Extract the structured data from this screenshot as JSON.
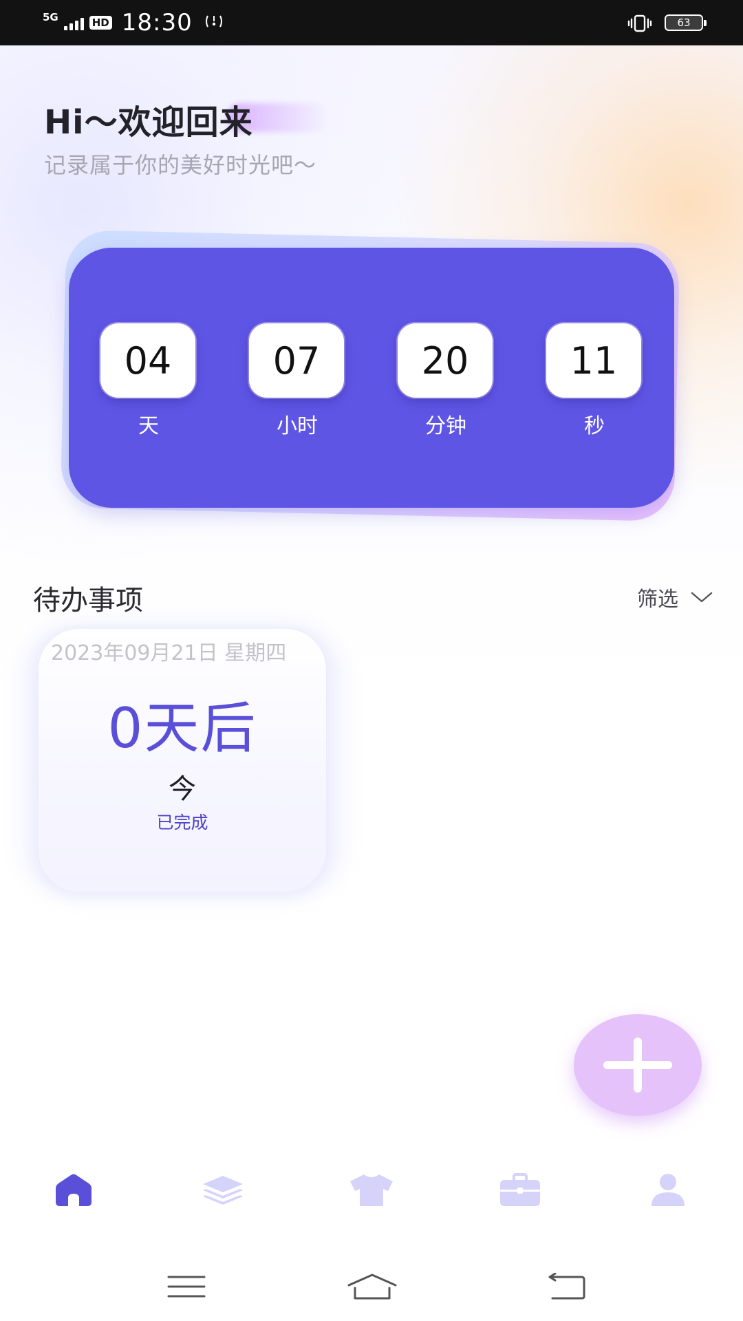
{
  "status_bar": {
    "network": "5G",
    "hd": "HD",
    "time": "18:30",
    "battery": "63",
    "icons": [
      "signal-icon",
      "hd-icon",
      "wifi-call-icon",
      "vibrate-icon",
      "battery-icon"
    ]
  },
  "greeting": {
    "title": "Hi～欢迎回来",
    "subtitle": "记录属于你的美好时光吧～"
  },
  "countdown": {
    "days_value": "04",
    "days_label": "天",
    "hours_value": "07",
    "hours_label": "小时",
    "minutes_value": "20",
    "minutes_label": "分钟",
    "seconds_value": "11",
    "seconds_label": "秒"
  },
  "todo": {
    "section_title": "待办事项",
    "filter_label": "筛选",
    "card": {
      "date": "2023年09月21日 星期四",
      "countdown": "0天后",
      "name": "今",
      "status": "已完成"
    }
  },
  "tabs": [
    {
      "icon": "home-icon",
      "active": true
    },
    {
      "icon": "layers-icon",
      "active": false
    },
    {
      "icon": "shirt-icon",
      "active": false
    },
    {
      "icon": "briefcase-icon",
      "active": false
    },
    {
      "icon": "user-icon",
      "active": false
    }
  ],
  "colors": {
    "primary": "#5F55E5",
    "tab_active": "#5A4FD8",
    "tab_inactive": "#D6D3FA",
    "fab": "#E6C2FB",
    "status_bar": "#121212"
  }
}
